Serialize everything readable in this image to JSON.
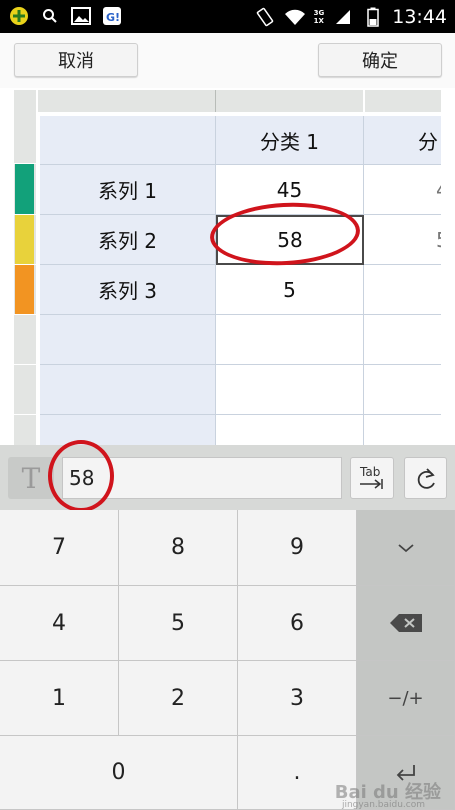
{
  "status_bar": {
    "time": "13:44",
    "network_top": "3G",
    "network_bottom": "1X",
    "icons": [
      "app-plus-icon",
      "search-icon",
      "image-icon",
      "notification-app-icon",
      "rotate-icon",
      "wifi-icon",
      "signal-icon",
      "battery-icon"
    ]
  },
  "toolbar": {
    "cancel_label": "取消",
    "confirm_label": "确定"
  },
  "sheet": {
    "column_headers": [
      "",
      "分类 1",
      "分"
    ],
    "rows": [
      {
        "label": "系列 1",
        "value": "45",
        "peek": "4",
        "color": "#12a17a"
      },
      {
        "label": "系列 2",
        "value": "58",
        "peek": "5",
        "color": "#e8d23b"
      },
      {
        "label": "系列 3",
        "value": "5",
        "peek": "",
        "color": "#f29422"
      }
    ],
    "selected_value": "58"
  },
  "formula_bar": {
    "type_glyph": "T",
    "input_value": "58",
    "tab_label": "Tab"
  },
  "keypad": {
    "keys": [
      "7",
      "8",
      "9",
      "4",
      "5",
      "6",
      "1",
      "2",
      "3",
      "0",
      "."
    ],
    "sign_label": "−/+"
  },
  "watermark": {
    "text": "Bai du 经验",
    "sub": "jingyan.baidu.com"
  },
  "colors": {
    "highlight_ring": "#d0141c",
    "header_blue": "#e7ecf6"
  }
}
